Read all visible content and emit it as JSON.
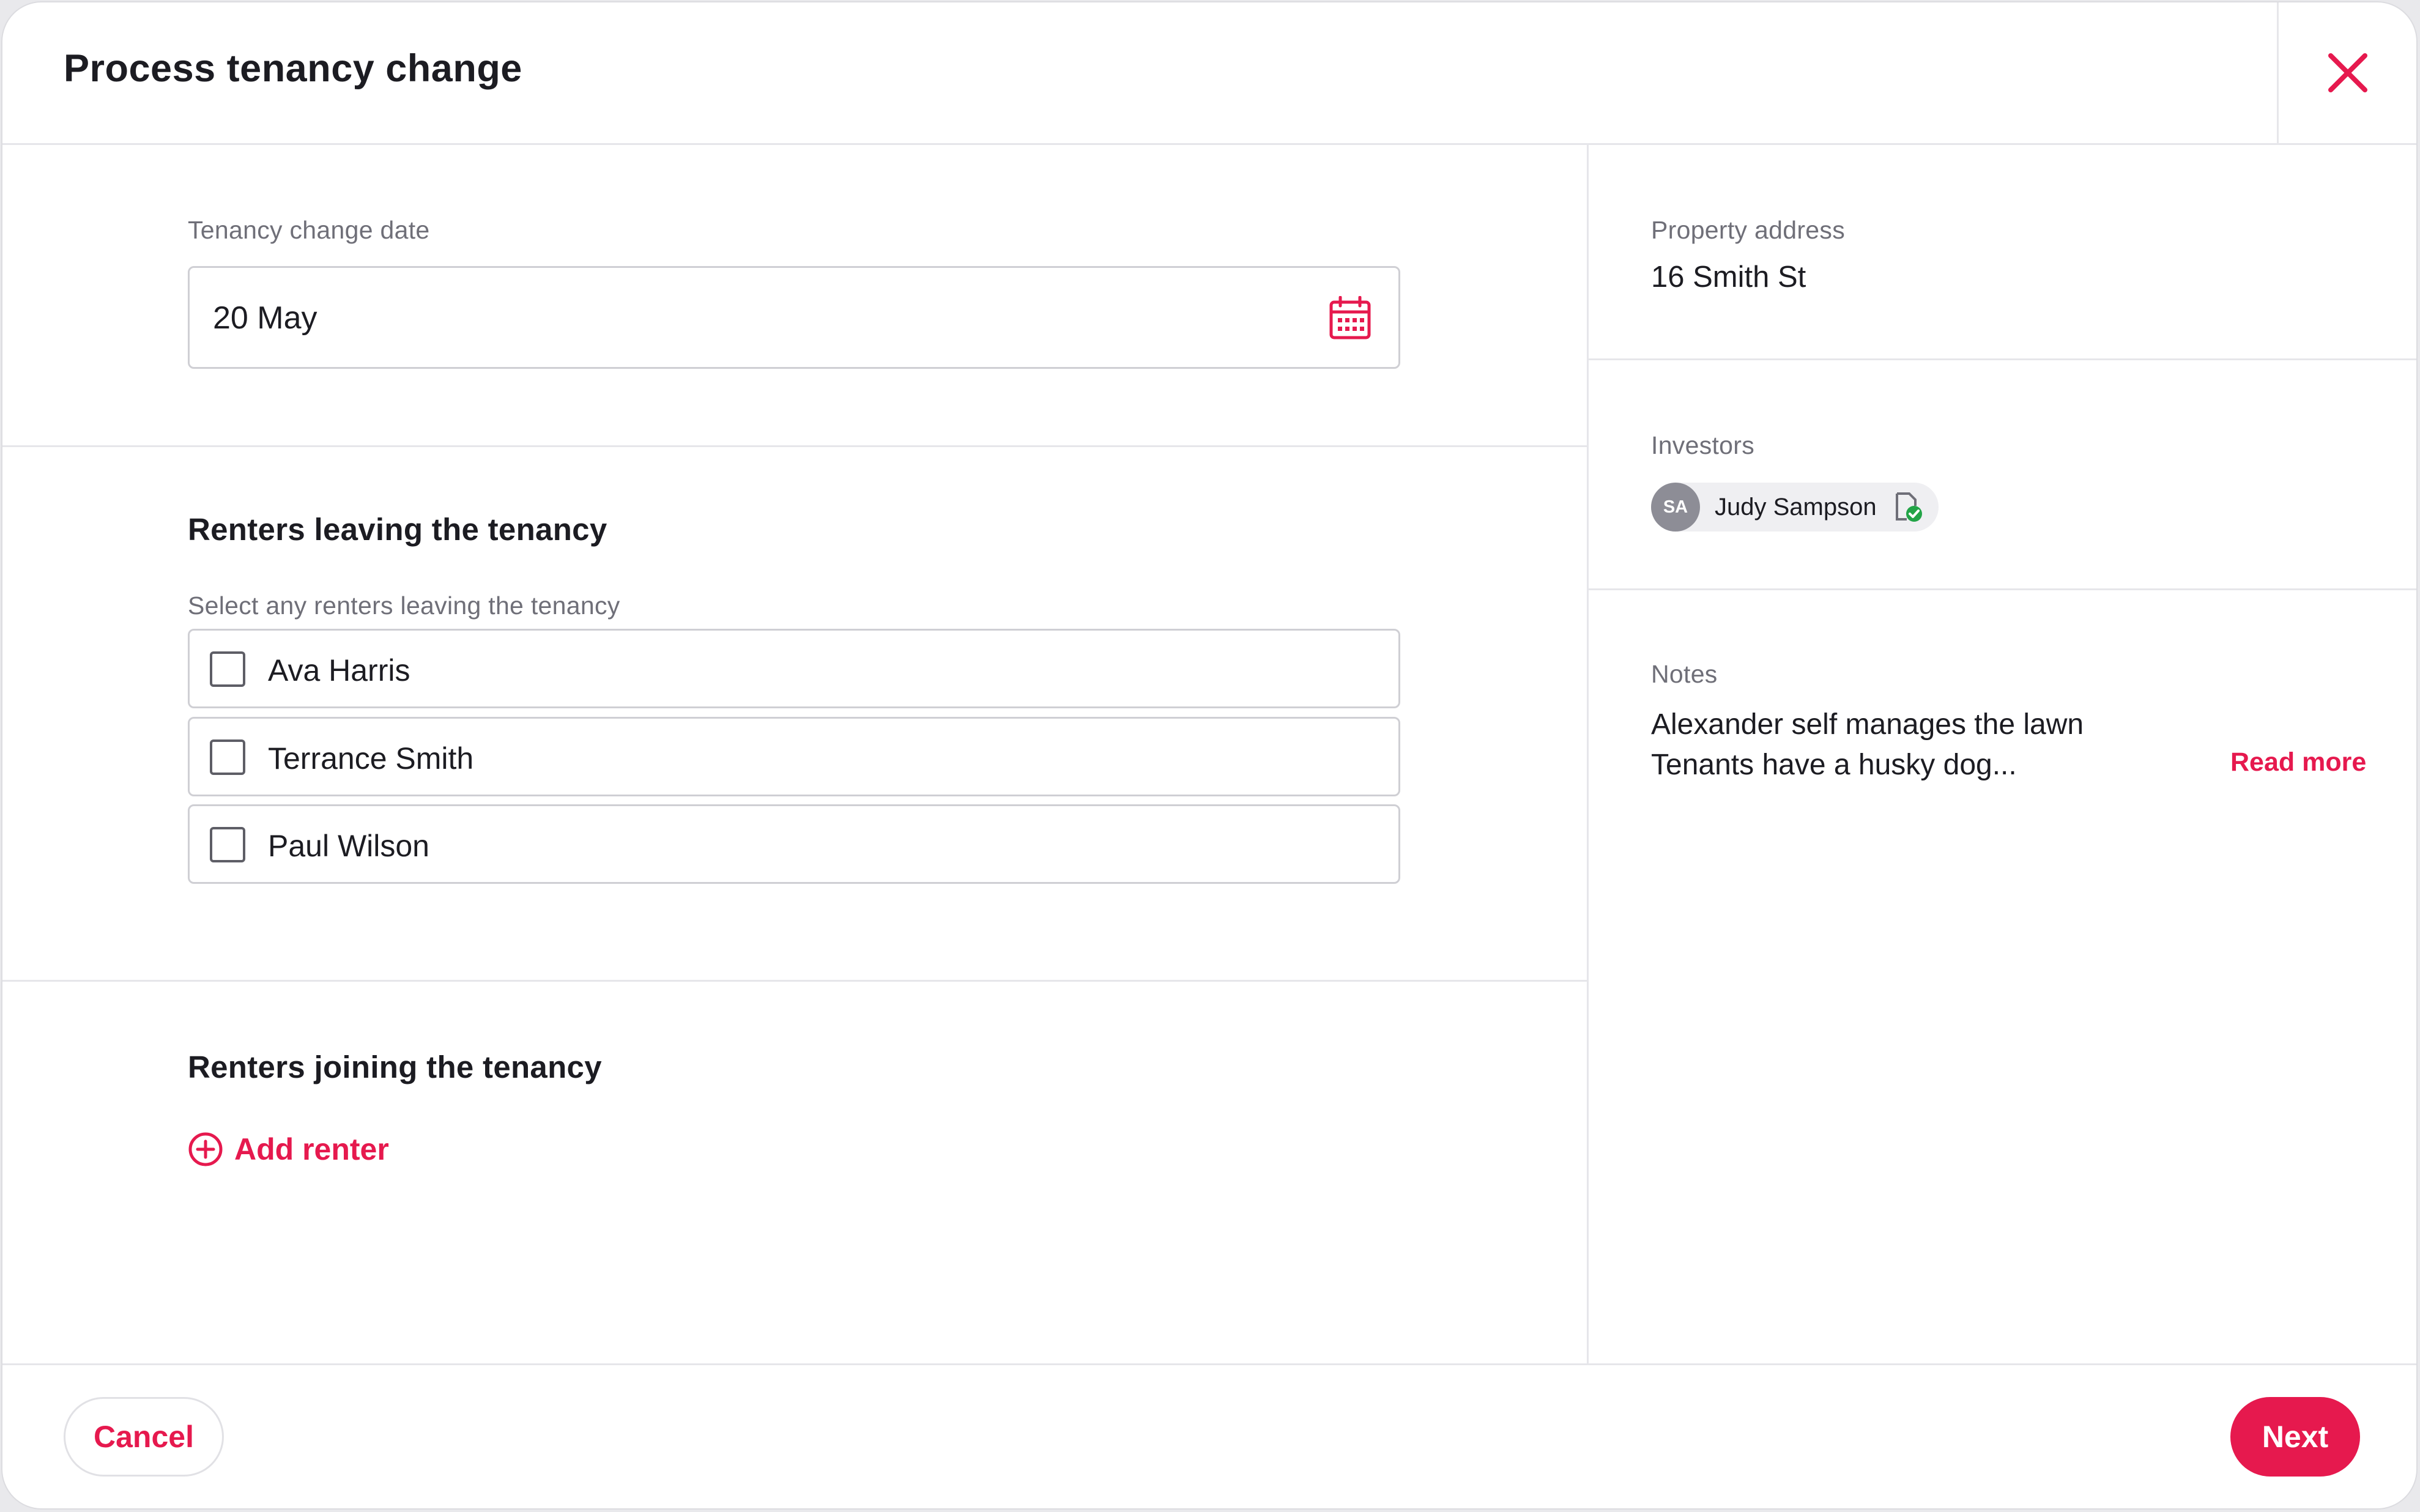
{
  "header": {
    "title": "Process tenancy change",
    "close_icon": "close-icon"
  },
  "date_section": {
    "label": "Tenancy change date",
    "value": "20 May",
    "icon": "calendar-icon"
  },
  "leaving_section": {
    "heading": "Renters leaving the tenancy",
    "hint": "Select any renters leaving the tenancy",
    "renters": [
      {
        "name": "Ava Harris",
        "checked": false
      },
      {
        "name": "Terrance Smith",
        "checked": false
      },
      {
        "name": "Paul Wilson",
        "checked": false
      }
    ]
  },
  "joining_section": {
    "heading": "Renters joining the tenancy",
    "add_label": "Add renter",
    "add_icon": "plus-circle-icon"
  },
  "sidebar": {
    "address_label": "Property address",
    "address_value": "16 Smith St",
    "investors_label": "Investors",
    "investor": {
      "initials": "SA",
      "name": "Judy Sampson",
      "status_icon": "document-verified-icon"
    },
    "notes_label": "Notes",
    "notes_line1": "Alexander self manages the lawn",
    "notes_line2": "Tenants have a husky dog...",
    "read_more": "Read more"
  },
  "footer": {
    "cancel_label": "Cancel",
    "next_label": "Next"
  },
  "colors": {
    "accent": "#e6194e",
    "text": "#1c1c22",
    "muted": "#6f6f78",
    "border": "#cfcfd4",
    "verified": "#22a447"
  }
}
